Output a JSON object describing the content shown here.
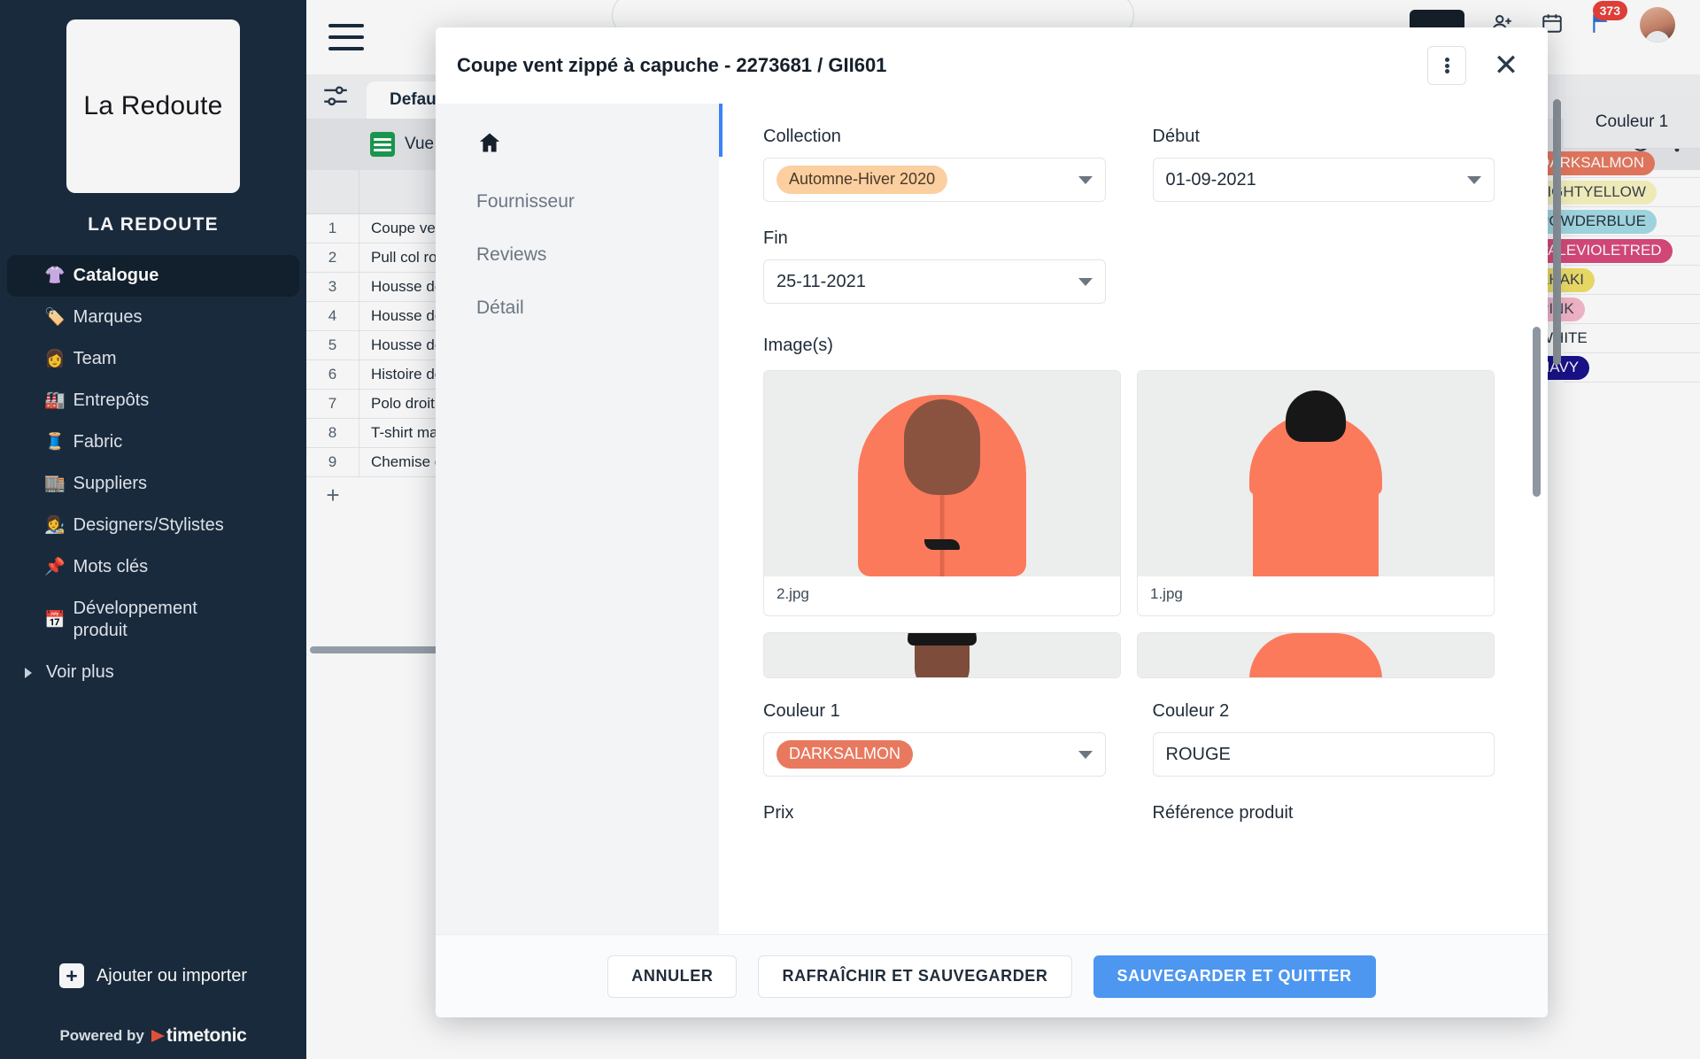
{
  "sidebar": {
    "logo_text": "La Redoute",
    "workspace_name": "LA REDOUTE",
    "items": [
      {
        "emoji": "👚",
        "label": "Catalogue",
        "active": true
      },
      {
        "emoji": "🏷️",
        "label": "Marques",
        "active": false
      },
      {
        "emoji": "👩",
        "label": "Team",
        "active": false
      },
      {
        "emoji": "🏭",
        "label": "Entrepôts",
        "active": false
      },
      {
        "emoji": "🧵",
        "label": "Fabric",
        "active": false
      },
      {
        "emoji": "🏬",
        "label": "Suppliers",
        "active": false
      },
      {
        "emoji": "👩‍🎨",
        "label": "Designers/Stylistes",
        "active": false
      },
      {
        "emoji": "📌",
        "label": "Mots clés",
        "active": false
      },
      {
        "emoji": "📅",
        "label": "Développement produit",
        "active": false
      }
    ],
    "see_more_label": "Voir plus",
    "add_import_label": "Ajouter ou importer",
    "powered_by_label": "Powered by",
    "powered_by_brand": "timetonic"
  },
  "topbar": {
    "notification_count": "373",
    "search_placeholder": "",
    "add_tab_label": "+"
  },
  "workspace": {
    "tab_label": "Default",
    "view_label": "Vue tableau"
  },
  "grid": {
    "row_numbers": [
      "1",
      "2",
      "3",
      "4",
      "5",
      "6",
      "7",
      "8",
      "9"
    ],
    "names": [
      "Coupe vent zippé à capuche",
      "Pull col roulé",
      "Housse de couette",
      "Housse de couette",
      "Housse de couette",
      "Histoire de la mode",
      "Polo droit",
      "T-shirt manches longues",
      "Chemise en lin"
    ],
    "add_row_label": "+",
    "color_column_header": "Couleur 1",
    "color_values": [
      {
        "label": "DARKSALMON",
        "bg": "#e8795f",
        "fg": "#ffffff"
      },
      {
        "label": "LIGHTYELLOW",
        "bg": "#f8f4c0",
        "fg": "#3b4350"
      },
      {
        "label": "POWDERBLUE",
        "bg": "#a5dbe6",
        "fg": "#27333f"
      },
      {
        "label": "PALEVIOLETRED",
        "bg": "#d9497c",
        "fg": "#ffffff"
      },
      {
        "label": "KHAKI",
        "bg": "#f0e06a",
        "fg": "#3b4350"
      },
      {
        "label": "PINK",
        "bg": "#f7b9cd",
        "fg": "#3b4350"
      },
      {
        "label": "WHITE",
        "bg": "#ffffff",
        "fg": "#1f2b38"
      },
      {
        "label": "NAVY",
        "bg": "#1b138c",
        "fg": "#ffffff"
      }
    ]
  },
  "modal": {
    "title": "Coupe vent zippé à capuche - 2273681 / GII601",
    "nav": [
      {
        "icon": "home-icon",
        "label": "🏠"
      },
      {
        "icon": "",
        "label": "Fournisseur"
      },
      {
        "icon": "",
        "label": "Reviews"
      },
      {
        "icon": "",
        "label": "Détail"
      }
    ],
    "fields": {
      "collection_label": "Collection",
      "collection_value": "Automne-Hiver 2020",
      "collection_tag_bg": "#fbcfa0",
      "collection_tag_fg": "#4a3a28",
      "debut_label": "Début",
      "debut_value": "01-09-2021",
      "fin_label": "Fin",
      "fin_value": "25-11-2021",
      "images_label": "Image(s)",
      "couleur1_label": "Couleur 1",
      "couleur1_value": "DARKSALMON",
      "couleur1_tag_bg": "#e8795f",
      "couleur1_tag_fg": "#ffffff",
      "couleur2_label": "Couleur 2",
      "couleur2_value": "ROUGE",
      "prix_label": "Prix",
      "reference_label": "Référence produit"
    },
    "images": [
      {
        "caption": "2.jpg",
        "kind": "front"
      },
      {
        "caption": "1.jpg",
        "kind": "back"
      },
      {
        "caption": "",
        "kind": "headshot"
      },
      {
        "caption": "",
        "kind": "fold"
      }
    ],
    "footer": {
      "cancel_label": "ANNULER",
      "refresh_save_label": "RAFRAÎCHIR ET SAUVEGARDER",
      "save_quit_label": "SAUVEGARDER ET QUITTER",
      "primary_color": "#4d97f0"
    }
  }
}
